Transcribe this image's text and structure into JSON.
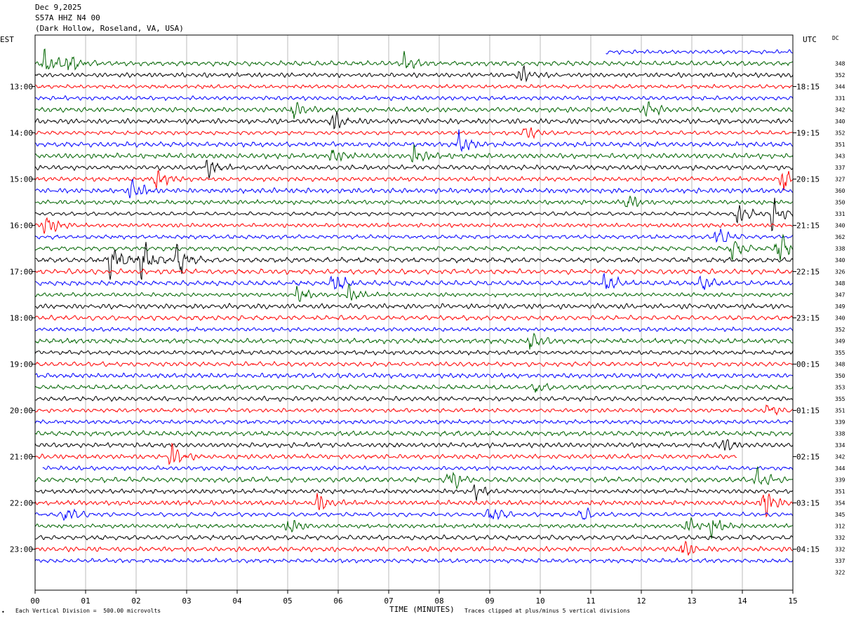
{
  "header": {
    "date": "Dec 9,2025",
    "station": "S57A HHZ N4 00",
    "location": "(Dark Hollow, Roseland, VA, USA)"
  },
  "labels": {
    "left_tz": "EST",
    "right_tz": "UTC",
    "dc": "DC",
    "xlabel": "TIME (MINUTES)",
    "footer_left": "Each Vertical Division =  500.00 microvolts",
    "footer_right": "Traces clipped at plus/minus 5 vertical divisions",
    "footer_mark": "•"
  },
  "colors": [
    "#0000ff",
    "#006400",
    "#000000",
    "#ff0000"
  ],
  "chart_data": {
    "type": "line",
    "title": "S57A HHZ N4 00",
    "xlabel": "TIME (MINUTES)",
    "xlim": [
      0,
      15
    ],
    "x_ticks": [
      "00",
      "01",
      "02",
      "03",
      "04",
      "05",
      "06",
      "07",
      "08",
      "09",
      "10",
      "11",
      "12",
      "13",
      "14",
      "15"
    ],
    "left_time_labels": [
      "13:00",
      "14:00",
      "15:00",
      "16:00",
      "17:00",
      "18:00",
      "19:00",
      "20:00",
      "21:00",
      "22:00",
      "23:00"
    ],
    "right_time_labels": [
      "18:15",
      "19:15",
      "20:15",
      "21:15",
      "22:15",
      "23:15",
      "00:15",
      "01:15",
      "02:15",
      "03:15",
      "04:15"
    ],
    "first_trace_start_minute": 11.3,
    "dc_offsets": [
      348,
      352,
      344,
      331,
      342,
      340,
      352,
      351,
      343,
      337,
      327,
      360,
      350,
      331,
      340,
      362,
      338,
      340,
      326,
      348,
      347,
      349,
      340,
      352,
      349,
      355,
      348,
      350,
      353,
      355,
      351,
      339,
      338,
      334,
      342,
      344,
      339,
      351,
      354,
      345,
      312,
      332,
      332,
      337,
      322
    ],
    "events": [
      {
        "trace": 1,
        "minute": 7.3,
        "amp": 2.2
      },
      {
        "trace": 2,
        "minute": 0.2,
        "amp": 1.8
      },
      {
        "trace": 2,
        "minute": 0.65,
        "amp": 1.4
      },
      {
        "trace": 2,
        "minute": 7.3,
        "amp": 1.3
      },
      {
        "trace": 3,
        "minute": 9.6,
        "amp": 1.3
      },
      {
        "trace": 6,
        "minute": 5.1,
        "amp": 1.4
      },
      {
        "trace": 6,
        "minute": 12.1,
        "amp": 1.5
      },
      {
        "trace": 7,
        "minute": 5.9,
        "amp": 1.2
      },
      {
        "trace": 8,
        "minute": 9.7,
        "amp": 1.4
      },
      {
        "trace": 9,
        "minute": 8.4,
        "amp": 1.6
      },
      {
        "trace": 10,
        "minute": 5.9,
        "amp": 1.2
      },
      {
        "trace": 10,
        "minute": 7.5,
        "amp": 1.5
      },
      {
        "trace": 11,
        "minute": 3.4,
        "amp": 1.3
      },
      {
        "trace": 12,
        "minute": 2.4,
        "amp": 1.5
      },
      {
        "trace": 12,
        "minute": 14.8,
        "amp": 2.2
      },
      {
        "trace": 13,
        "minute": 1.9,
        "amp": 1.6
      },
      {
        "trace": 14,
        "minute": 11.7,
        "amp": 1.3
      },
      {
        "trace": 15,
        "minute": 13.9,
        "amp": 2.0
      },
      {
        "trace": 15,
        "minute": 14.6,
        "amp": 2.5
      },
      {
        "trace": 16,
        "minute": 0.2,
        "amp": 2.0
      },
      {
        "trace": 17,
        "minute": 13.5,
        "amp": 1.6
      },
      {
        "trace": 18,
        "minute": 13.8,
        "amp": 1.5
      },
      {
        "trace": 18,
        "minute": 14.7,
        "amp": 2.4
      },
      {
        "trace": 19,
        "minute": 1.5,
        "amp": 3.0
      },
      {
        "trace": 19,
        "minute": 2.1,
        "amp": 3.0
      },
      {
        "trace": 19,
        "minute": 2.8,
        "amp": 2.5
      },
      {
        "trace": 21,
        "minute": 5.9,
        "amp": 1.6
      },
      {
        "trace": 21,
        "minute": 11.3,
        "amp": 1.8
      },
      {
        "trace": 21,
        "minute": 13.2,
        "amp": 1.4
      },
      {
        "trace": 22,
        "minute": 5.2,
        "amp": 1.3
      },
      {
        "trace": 22,
        "minute": 6.2,
        "amp": 1.3
      },
      {
        "trace": 26,
        "minute": 9.8,
        "amp": 1.4
      },
      {
        "trace": 30,
        "minute": 9.9,
        "amp": 0.9
      },
      {
        "trace": 32,
        "minute": 14.5,
        "amp": 1.1
      },
      {
        "trace": 35,
        "minute": 13.6,
        "amp": 1.2
      },
      {
        "trace": 36,
        "minute": 2.7,
        "amp": 1.9
      },
      {
        "trace": 38,
        "minute": 8.2,
        "amp": 2.0
      },
      {
        "trace": 38,
        "minute": 14.3,
        "amp": 1.4
      },
      {
        "trace": 39,
        "minute": 8.7,
        "amp": 1.2
      },
      {
        "trace": 40,
        "minute": 5.6,
        "amp": 1.4
      },
      {
        "trace": 40,
        "minute": 14.4,
        "amp": 2.5
      },
      {
        "trace": 41,
        "minute": 0.6,
        "amp": 1.4
      },
      {
        "trace": 41,
        "minute": 9.0,
        "amp": 1.7
      },
      {
        "trace": 41,
        "minute": 10.8,
        "amp": 1.2
      },
      {
        "trace": 42,
        "minute": 5.0,
        "amp": 1.3
      },
      {
        "trace": 42,
        "minute": 12.9,
        "amp": 1.3
      },
      {
        "trace": 42,
        "minute": 13.4,
        "amp": 1.4
      },
      {
        "trace": 44,
        "minute": 12.8,
        "amp": 1.3
      }
    ]
  }
}
